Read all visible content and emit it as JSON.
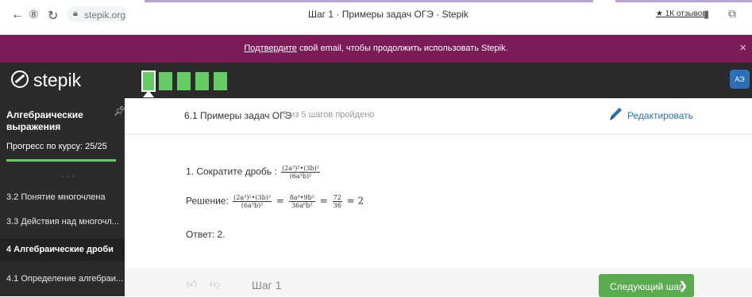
{
  "browser": {
    "url": "stepik.org",
    "tab_title": "Шаг 1 · Примеры задач ОГЭ · Stepik",
    "reviews": "★ 1К отзывов"
  },
  "notice": {
    "link": "Подтвердите",
    "text": " свой email, чтобы продолжить использовать Stepik.",
    "close": "×"
  },
  "header": {
    "logo": "stepik",
    "avatar": "АЭ",
    "steps_total": 5,
    "steps_passed": 5
  },
  "sidebar": {
    "course_title": "Алгебраические выражения",
    "progress_text": "Прогресс по курсу:  25/25",
    "progress_fraction": 1.0,
    "dots": "· · ·",
    "items": [
      {
        "label": "3.2  Понятие многочлена"
      },
      {
        "label": "3.3  Действия над многочл..."
      },
      {
        "label": "4  Алгебраические дроби"
      },
      {
        "label": "4.1  Определение алгебраи..."
      }
    ]
  },
  "lesson": {
    "title": "6.1 Примеры задач ОГЭ",
    "progress": "5 из 5 шагов пройдено",
    "edit": "Редактировать"
  },
  "task": {
    "label": "1. Сократите дробь : ",
    "frac_num": "(2a³)²•(3b)²",
    "frac_den": "(6a³b)²",
    "solution_label": "Решение: ",
    "s1_num": "(2a³)²•(3b)²",
    "s1_den": "(6a³b)²",
    "s2_num": "8a⁶•9b²",
    "s2_den": "36a⁶b²",
    "s3_num": "72",
    "s3_den": "36",
    "eq": " = ",
    "result": "2",
    "answer": "Ответ: 2."
  },
  "footer": {
    "step_label": "Шаг 1",
    "next_button": "Следующий шаг"
  }
}
